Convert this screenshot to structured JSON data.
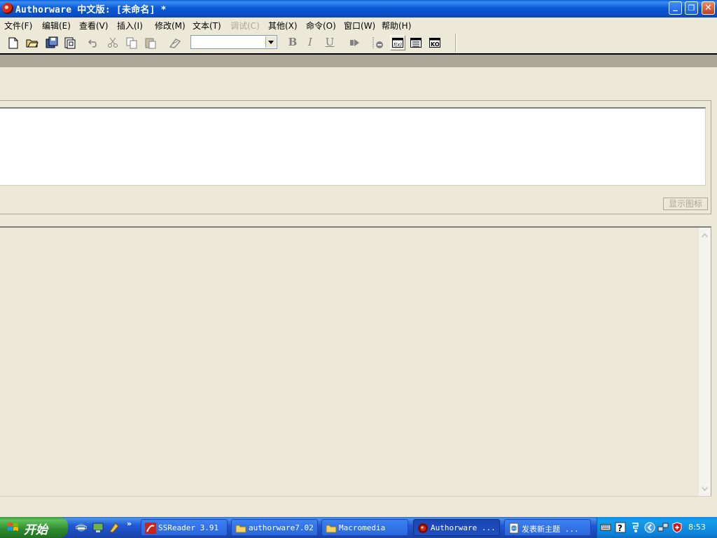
{
  "window": {
    "title": "Authorware 中文版: [未命名] *",
    "minimize_glyph": "_",
    "restore_glyph": "❐",
    "close_glyph": "✕"
  },
  "menu": [
    {
      "label": "文件(F)",
      "enabled": true
    },
    {
      "label": "编辑(E)",
      "enabled": true
    },
    {
      "label": "查看(V)",
      "enabled": true
    },
    {
      "label": "插入(I)",
      "enabled": true
    },
    {
      "label": "修改(M)",
      "enabled": true
    },
    {
      "label": "文本(T)",
      "enabled": true
    },
    {
      "label": "调试(C)",
      "enabled": false
    },
    {
      "label": "其他(X)",
      "enabled": true
    },
    {
      "label": "命令(O)",
      "enabled": true
    },
    {
      "label": "窗口(W)",
      "enabled": true
    },
    {
      "label": "帮助(H)",
      "enabled": true
    }
  ],
  "toolbar": {
    "font_select_value": "",
    "bold_label": "B",
    "italic_label": "I",
    "underline_label": "U"
  },
  "upper_pane": {
    "show_icons_button": "显示图标"
  },
  "taskbar": {
    "start_label": "开始",
    "chevron": "»",
    "tasks": [
      {
        "label": "SSReader 3.91",
        "icon": "ssreader-icon",
        "active": false
      },
      {
        "label": "authorware7.02",
        "icon": "folder-icon",
        "active": false
      },
      {
        "label": "Macromedia",
        "icon": "folder-icon",
        "active": false
      },
      {
        "label": "Authorware ...",
        "icon": "authorware-icon",
        "active": true
      },
      {
        "label": "发表新主题 ...",
        "icon": "ie-page-icon",
        "active": false
      }
    ],
    "clock": "8:53"
  },
  "colors": {
    "window_bg": "#ece9d8",
    "titlebar_blue": "#0a4fc9",
    "taskbar_blue": "#2157d7",
    "start_green": "#3c9a3c"
  }
}
